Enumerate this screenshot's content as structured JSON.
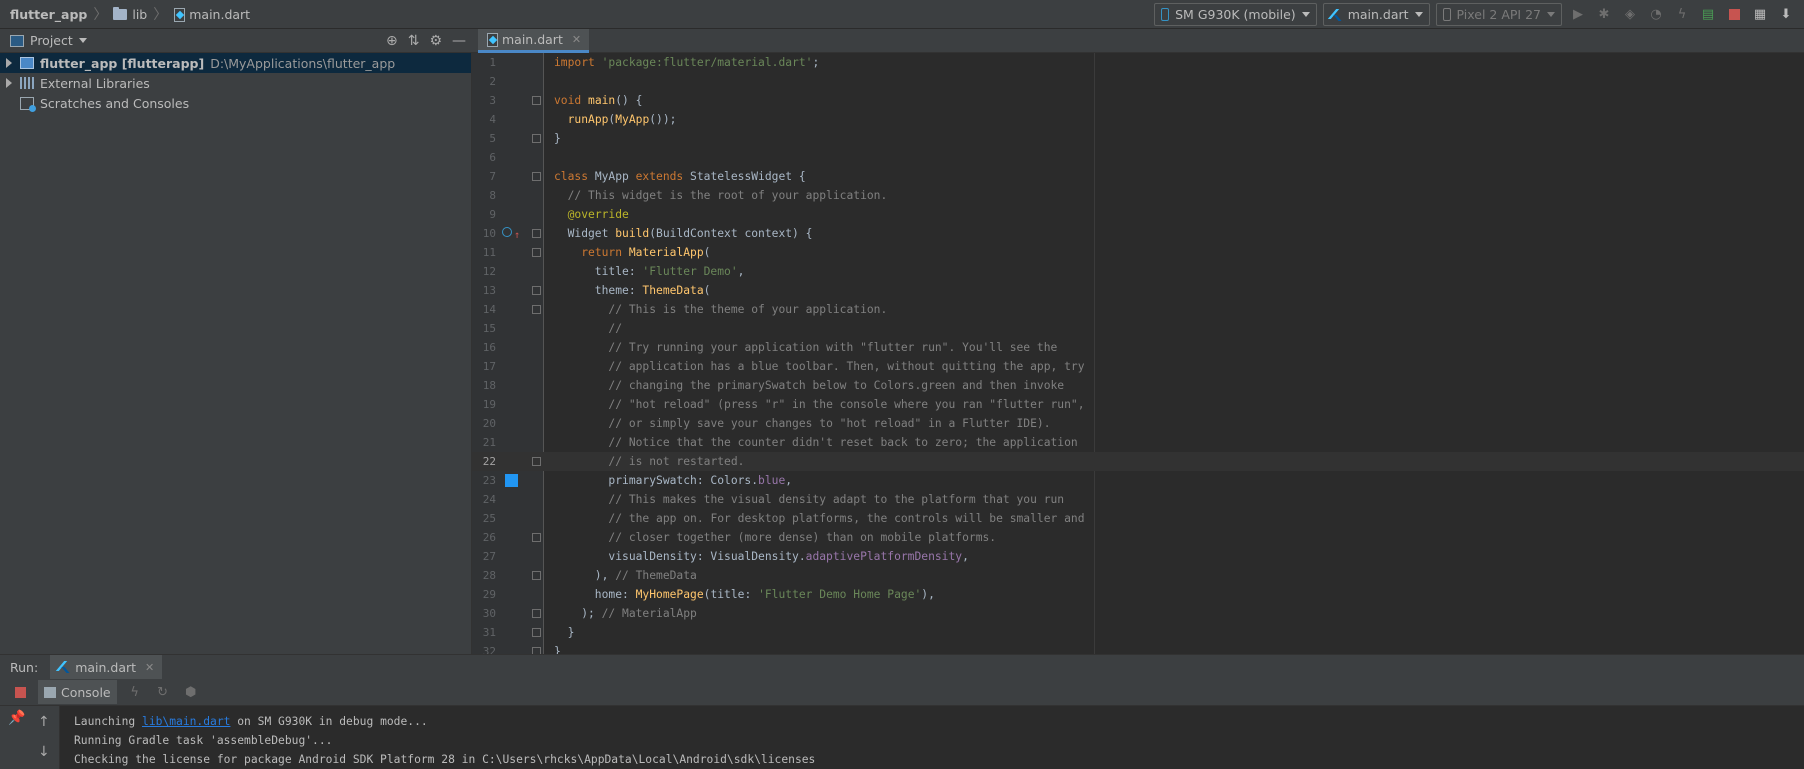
{
  "breadcrumb": {
    "project": "flutter_app",
    "folder": "lib",
    "file": "main.dart"
  },
  "toolbar": {
    "device": "SM G930K (mobile)",
    "run_config": "main.dart",
    "emulator": "Pixel 2 API 27"
  },
  "project_panel": {
    "title": "Project",
    "tree": [
      {
        "name": "flutter_app [flutterapp]",
        "path": "D:\\MyApplications\\flutter_app"
      },
      {
        "name": "External Libraries"
      },
      {
        "name": "Scratches and Consoles"
      }
    ]
  },
  "editor": {
    "tab": "main.dart",
    "current_line": 22,
    "lines": [
      {
        "n": "1",
        "t": "import 'package:flutter/material.dart';"
      },
      {
        "n": "2",
        "t": ""
      },
      {
        "n": "3",
        "t": "void main() {"
      },
      {
        "n": "4",
        "t": "  runApp(MyApp());"
      },
      {
        "n": "5",
        "t": "}"
      },
      {
        "n": "6",
        "t": ""
      },
      {
        "n": "7",
        "t": "class MyApp extends StatelessWidget {"
      },
      {
        "n": "8",
        "t": "  // This widget is the root of your application."
      },
      {
        "n": "9",
        "t": "  @override"
      },
      {
        "n": "10",
        "t": "  Widget build(BuildContext context) {"
      },
      {
        "n": "11",
        "t": "    return MaterialApp("
      },
      {
        "n": "12",
        "t": "      title: 'Flutter Demo',"
      },
      {
        "n": "13",
        "t": "      theme: ThemeData("
      },
      {
        "n": "14",
        "t": "        // This is the theme of your application."
      },
      {
        "n": "15",
        "t": "        //"
      },
      {
        "n": "16",
        "t": "        // Try running your application with \"flutter run\". You'll see the"
      },
      {
        "n": "17",
        "t": "        // application has a blue toolbar. Then, without quitting the app, try"
      },
      {
        "n": "18",
        "t": "        // changing the primarySwatch below to Colors.green and then invoke"
      },
      {
        "n": "19",
        "t": "        // \"hot reload\" (press \"r\" in the console where you ran \"flutter run\","
      },
      {
        "n": "20",
        "t": "        // or simply save your changes to \"hot reload\" in a Flutter IDE)."
      },
      {
        "n": "21",
        "t": "        // Notice that the counter didn't reset back to zero; the application"
      },
      {
        "n": "22",
        "t": "        // is not restarted."
      },
      {
        "n": "23",
        "t": "        primarySwatch: Colors.blue,"
      },
      {
        "n": "24",
        "t": "        // This makes the visual density adapt to the platform that you run"
      },
      {
        "n": "25",
        "t": "        // the app on. For desktop platforms, the controls will be smaller and"
      },
      {
        "n": "26",
        "t": "        // closer together (more dense) than on mobile platforms."
      },
      {
        "n": "27",
        "t": "        visualDensity: VisualDensity.adaptivePlatformDensity,"
      },
      {
        "n": "28",
        "t": "      ), // ThemeData"
      },
      {
        "n": "29",
        "t": "      home: MyHomePage(title: 'Flutter Demo Home Page'),"
      },
      {
        "n": "30",
        "t": "    ); // MaterialApp"
      },
      {
        "n": "31",
        "t": "  }"
      },
      {
        "n": "32",
        "t": "}"
      }
    ]
  },
  "run_panel": {
    "label": "Run:",
    "tab": "main.dart",
    "console_tab": "Console",
    "output": {
      "line1_prefix": "Launching ",
      "line1_link": "lib\\main.dart",
      "line1_suffix": " on SM G930K in debug mode...",
      "line2": "Running Gradle task 'assembleDebug'...",
      "line3": "Checking the license for package Android SDK Platform 28 in C:\\Users\\rhcks\\AppData\\Local\\Android\\sdk\\licenses"
    }
  },
  "colors": {
    "editor_bg": "#2b2b2b",
    "panel_bg": "#3c3f41",
    "keyword": "#cc7832",
    "string": "#6a8759",
    "comment": "#808080",
    "swatch_blue": "#2196f3",
    "link": "#287bde"
  }
}
